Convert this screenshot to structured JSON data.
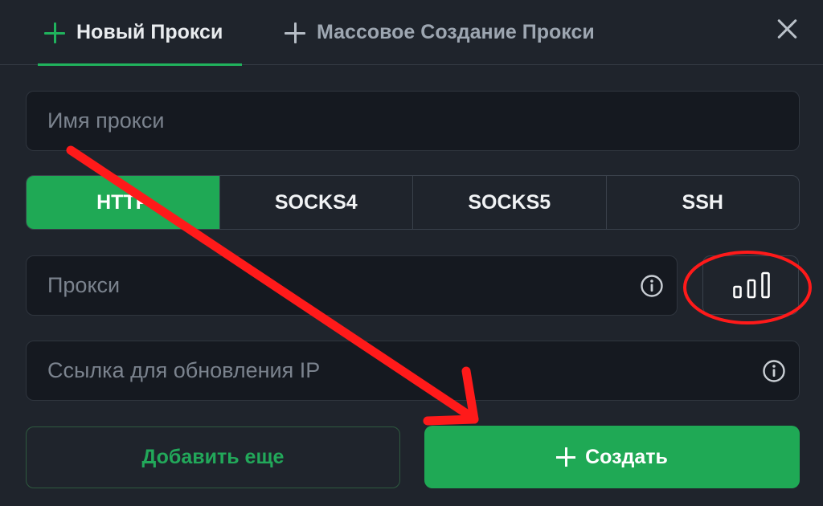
{
  "tabs": [
    {
      "label": "Новый Прокси",
      "active": true
    },
    {
      "label": "Массовое Создание Прокси",
      "active": false
    }
  ],
  "form": {
    "proxy_name_placeholder": "Имя прокси",
    "proxy_placeholder": "Прокси",
    "refresh_url_placeholder": "Ссылка для обновления IP"
  },
  "protocols": [
    "HTTP",
    "SOCKS4",
    "SOCKS5",
    "SSH"
  ],
  "selected_protocol": "HTTP",
  "buttons": {
    "add_more": "Добавить еще",
    "create": "Создать"
  },
  "icons": {
    "tab_plus": "plus-icon",
    "close": "close-icon",
    "info": "info-icon",
    "signal": "signal-bars-icon"
  },
  "colors": {
    "accent": "#1fa955",
    "background": "#1f242c",
    "input_bg": "#151920",
    "annotation": "#ff1a1a"
  }
}
